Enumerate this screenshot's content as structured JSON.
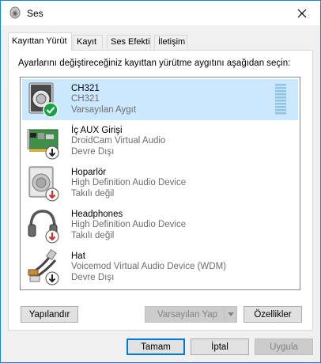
{
  "window": {
    "title": "Ses"
  },
  "tabs": [
    {
      "label": "Kayıttan Yürüt"
    },
    {
      "label": "Kayıt"
    },
    {
      "label": "Ses Efekti"
    },
    {
      "label": "İletişim"
    }
  ],
  "instruction": "Ayarlarını değiştireceğiniz kayıttan yürütme aygıtını aşağıdan seçin:",
  "devices": [
    {
      "name": "CH321",
      "description": "CH321",
      "status": "Varsayılan Aygıt",
      "icon": "speaker-icon",
      "badge": "default-check-icon",
      "selected": true
    },
    {
      "name": "İç AUX Girişi",
      "description": "DroidCam Virtual Audio",
      "status": "Devre Dışı",
      "icon": "sound-card-icon",
      "badge": "disabled-arrow-icon",
      "selected": false
    },
    {
      "name": "Hoparlör",
      "description": "High Definition Audio Device",
      "status": "Takılı değil",
      "icon": "speaker-icon",
      "badge": "unplugged-arrow-icon",
      "selected": false
    },
    {
      "name": "Headphones",
      "description": "High Definition Audio Device",
      "status": "Takılı değil",
      "icon": "headphones-icon",
      "badge": "unplugged-arrow-icon",
      "selected": false
    },
    {
      "name": "Hat",
      "description": "Voicemod Virtual Audio Device (WDM)",
      "status": "Devre Dışı",
      "icon": "cable-jack-icon",
      "badge": "disabled-arrow-icon",
      "selected": false
    }
  ],
  "buttons": {
    "configure": "Yapılandır",
    "set_default": "Varsayılan Yap",
    "properties": "Özellikler",
    "ok": "Tamam",
    "cancel": "İptal",
    "apply": "Uygula"
  },
  "colors": {
    "accent": "#0078d7",
    "selection": "#cce8ff",
    "check_green": "#16a34a",
    "unplugged_red": "#d32f2f"
  }
}
